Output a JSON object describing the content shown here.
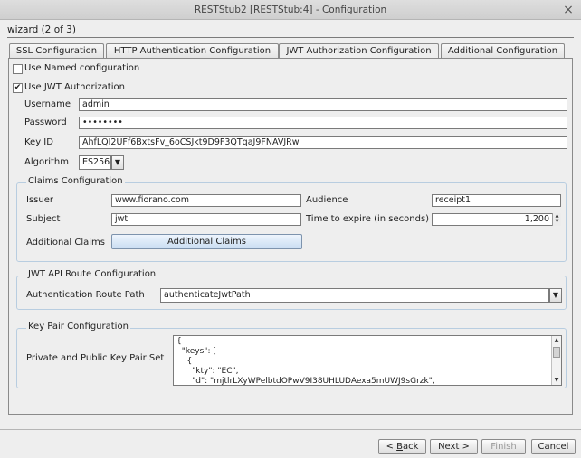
{
  "window": {
    "title": "RESTStub2 [RESTStub:4] - Configuration",
    "close_glyph": "×"
  },
  "wizard": {
    "header": "wizard (2 of 3)"
  },
  "tabs": [
    {
      "label": "SSL Configuration"
    },
    {
      "label": "HTTP Authentication Configuration"
    },
    {
      "label": "JWT Authorization Configuration",
      "active": true
    },
    {
      "label": "Additional Configuration"
    }
  ],
  "form": {
    "use_named_config": {
      "label": "Use Named configuration",
      "checked": false
    },
    "use_jwt": {
      "label": "Use JWT Authorization",
      "checked": true,
      "glyph": "✔"
    },
    "username": {
      "label": "Username",
      "value": "admin"
    },
    "password": {
      "label": "Password",
      "value": "••••••••"
    },
    "key_id": {
      "label": "Key ID",
      "value": "AhfLQI2UFf6BxtsFv_6oCSJkt9D9F3QTqaJ9FNAVJRw"
    },
    "algorithm": {
      "label": "Algorithm",
      "value": "ES256"
    }
  },
  "claims": {
    "title": "Claims Configuration",
    "issuer": {
      "label": "Issuer",
      "value": "www.fiorano.com"
    },
    "audience": {
      "label": "Audience",
      "value": "receipt1"
    },
    "subject": {
      "label": "Subject",
      "value": "jwt"
    },
    "expire": {
      "label": "Time to expire (in seconds)",
      "value": "1,200"
    },
    "additional": {
      "label": "Additional Claims",
      "button": "Additional Claims"
    }
  },
  "route": {
    "title": "JWT API Route Configuration",
    "auth_path": {
      "label": "Authentication Route Path",
      "value": "authenticateJwtPath"
    }
  },
  "keypair": {
    "title": "Key Pair Configuration",
    "label": "Private and Public Key Pair Set",
    "text": "{\n  \"keys\": [\n    {\n      \"kty\": \"EC\",\n      \"d\": \"mjtlrLXyWPelbtdOPwV9I38UHLUDAexa5mUWJ9sGrzk\","
  },
  "footer": {
    "back": {
      "label": "Back",
      "prefix": "< ",
      "mnemonic": "B",
      "rest": "ack"
    },
    "next": "Next >",
    "finish": "Finish",
    "cancel": "Cancel"
  },
  "icons": {
    "arrow_down": "▼",
    "arrow_up": "▲"
  }
}
